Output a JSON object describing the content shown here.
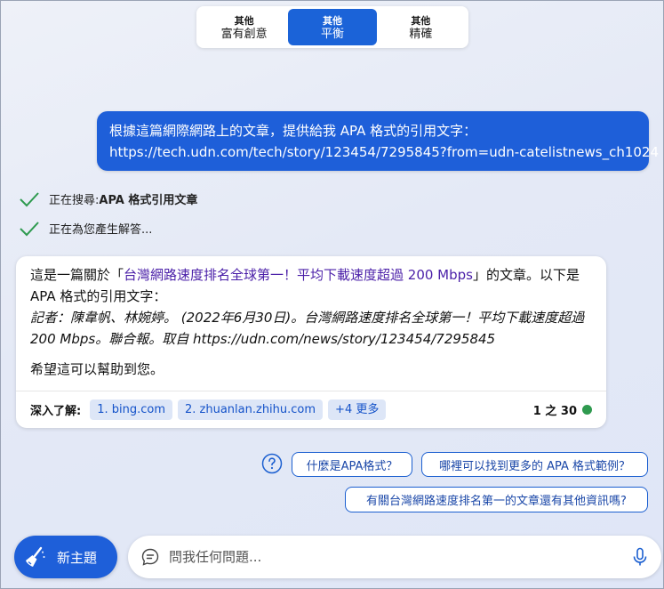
{
  "tone_selector": {
    "options": [
      {
        "line1": "其他",
        "line2": "富有創意",
        "active": false
      },
      {
        "line1": "其他",
        "line2": "平衡",
        "active": true
      },
      {
        "line1": "其他",
        "line2": "精確",
        "active": false
      }
    ]
  },
  "user_message": {
    "line1": "根據這篇網際網路上的文章，提供給我 APA 格式的引用文字：",
    "line2": "https://tech.udn.com/tech/story/123454/7295845?from=udn-catelistnews_ch1024"
  },
  "status": {
    "searching_prefix": "正在搜尋: ",
    "searching_query": "APA 格式引用文章",
    "generating": "正在為您產生解答..."
  },
  "answer": {
    "intro_before": "這是一篇關於「",
    "article_title": "台灣網路速度排名全球第一！平均下載速度超過 200 Mbps",
    "intro_after": "」的文章。以下是 APA 格式的引用文字：",
    "citation": "記者：陳韋帆、林婉婷。 (2022年6月30日)。台灣網路速度排名全球第一！平均下載速度超過 200 Mbps。聯合報。取自 https://udn.com/news/story/123454/7295845",
    "closing": "希望這可以幫助到您。",
    "learn_more_label": "深入了解:",
    "sources": [
      "1. bing.com",
      "2. zhuanlan.zhihu.com",
      "+4 更多"
    ],
    "counter": "1 之 30",
    "status_color": "#2f9a4f"
  },
  "suggestions": [
    "什麼是APA格式？",
    "哪裡可以找到更多的 APA 格式範例？",
    "有關台灣網路速度排名第一的文章還有其他資訊嗎?"
  ],
  "bottom": {
    "new_topic_label": "新主題",
    "input_placeholder": "問我任何問題..."
  },
  "colors": {
    "accent": "#1e5fd9",
    "check": "#2e9a4f"
  }
}
